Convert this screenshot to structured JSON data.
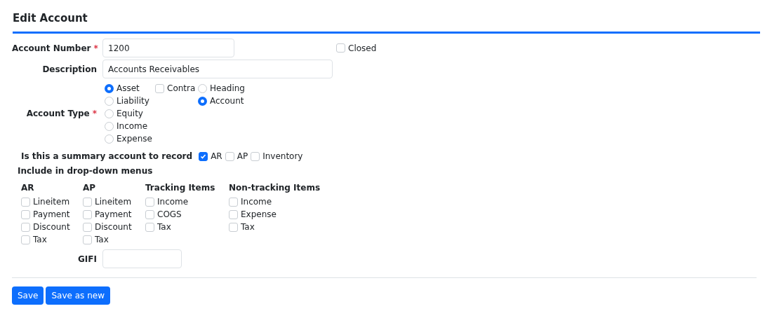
{
  "title": "Edit Account",
  "account_number": {
    "label": "Account Number",
    "required_mark": "*",
    "value": "1200"
  },
  "closed": {
    "label": "Closed",
    "checked": false
  },
  "description": {
    "label": "Description",
    "value": "Accounts Receivables"
  },
  "account_type": {
    "label": "Account Type",
    "required_mark": "*",
    "options": [
      {
        "label": "Asset",
        "selected": true
      },
      {
        "label": "Liability",
        "selected": false
      },
      {
        "label": "Equity",
        "selected": false
      },
      {
        "label": "Income",
        "selected": false
      },
      {
        "label": "Expense",
        "selected": false
      }
    ],
    "contra": {
      "label": "Contra",
      "checked": false
    },
    "category": [
      {
        "label": "Heading",
        "selected": false
      },
      {
        "label": "Account",
        "selected": true
      }
    ]
  },
  "summary": {
    "label": "Is this a summary account to record",
    "options": [
      {
        "label": "AR",
        "checked": true
      },
      {
        "label": "AP",
        "checked": false
      },
      {
        "label": "Inventory",
        "checked": false
      }
    ]
  },
  "dropdown_menus": {
    "label": "Include in drop-down menus",
    "groups": [
      {
        "title": "AR",
        "items": [
          {
            "label": "Lineitem",
            "checked": false
          },
          {
            "label": "Payment",
            "checked": false
          },
          {
            "label": "Discount",
            "checked": false
          },
          {
            "label": "Tax",
            "checked": false
          }
        ]
      },
      {
        "title": "AP",
        "items": [
          {
            "label": "Lineitem",
            "checked": false
          },
          {
            "label": "Payment",
            "checked": false
          },
          {
            "label": "Discount",
            "checked": false
          },
          {
            "label": "Tax",
            "checked": false
          }
        ]
      },
      {
        "title": "Tracking Items",
        "items": [
          {
            "label": "Income",
            "checked": false
          },
          {
            "label": "COGS",
            "checked": false
          },
          {
            "label": "Tax",
            "checked": false
          }
        ]
      },
      {
        "title": "Non-tracking Items",
        "items": [
          {
            "label": "Income",
            "checked": false
          },
          {
            "label": "Expense",
            "checked": false
          },
          {
            "label": "Tax",
            "checked": false
          }
        ]
      }
    ]
  },
  "gifi": {
    "label": "GIFI"
  },
  "buttons": [
    {
      "label": "Save"
    },
    {
      "label": "Save as new"
    }
  ]
}
